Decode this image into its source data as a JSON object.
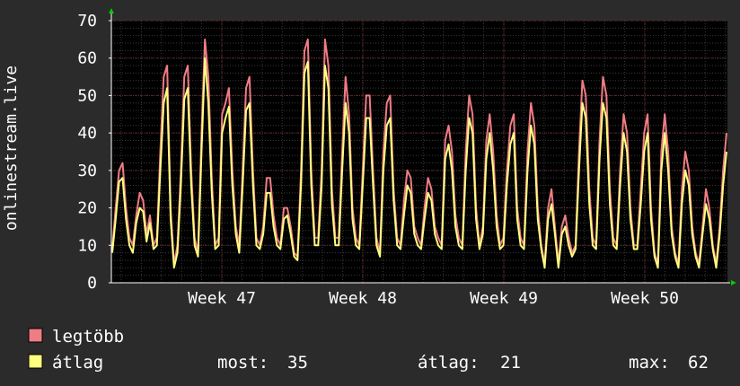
{
  "chart_data": {
    "type": "line",
    "title": "",
    "ylabel": "onlinestream.live",
    "ylim": [
      0,
      70
    ],
    "yticks": [
      0,
      10,
      20,
      30,
      40,
      50,
      60,
      70
    ],
    "xticks": [
      "Week 47",
      "Week 48",
      "Week 49",
      "Week 50"
    ],
    "grid": true,
    "legend": "bottom",
    "series": [
      {
        "name": "legtöbb",
        "color": "#f07c84",
        "values": [
          9,
          20,
          30,
          32,
          20,
          12,
          10,
          18,
          24,
          22,
          13,
          18,
          10,
          12,
          35,
          55,
          58,
          20,
          5,
          10,
          30,
          55,
          58,
          30,
          12,
          8,
          40,
          65,
          55,
          28,
          10,
          12,
          45,
          48,
          52,
          30,
          15,
          10,
          30,
          52,
          55,
          30,
          12,
          10,
          15,
          28,
          28,
          18,
          12,
          10,
          20,
          20,
          15,
          8,
          7,
          30,
          62,
          65,
          30,
          12,
          12,
          30,
          65,
          58,
          25,
          12,
          12,
          35,
          55,
          45,
          20,
          12,
          10,
          30,
          50,
          50,
          30,
          12,
          8,
          35,
          48,
          50,
          25,
          12,
          10,
          22,
          30,
          28,
          15,
          12,
          10,
          20,
          28,
          25,
          15,
          12,
          10,
          38,
          42,
          35,
          18,
          12,
          10,
          35,
          50,
          45,
          20,
          10,
          15,
          38,
          45,
          35,
          18,
          10,
          12,
          30,
          42,
          45,
          20,
          12,
          10,
          35,
          48,
          42,
          20,
          10,
          5,
          20,
          25,
          15,
          5,
          15,
          18,
          12,
          8,
          10,
          35,
          54,
          50,
          25,
          12,
          10,
          38,
          55,
          50,
          25,
          12,
          10,
          30,
          45,
          40,
          20,
          10,
          10,
          25,
          40,
          45,
          20,
          8,
          5,
          35,
          45,
          35,
          15,
          8,
          5,
          25,
          35,
          30,
          15,
          8,
          5,
          15,
          25,
          20,
          10,
          5,
          15,
          30,
          40
        ]
      },
      {
        "name": "átlag",
        "color": "#ffff80",
        "values": [
          8,
          17,
          27,
          28,
          17,
          10,
          8,
          16,
          20,
          19,
          11,
          16,
          9,
          10,
          30,
          48,
          52,
          17,
          4,
          8,
          26,
          49,
          52,
          26,
          10,
          7,
          35,
          60,
          48,
          24,
          9,
          10,
          40,
          44,
          47,
          26,
          13,
          8,
          26,
          46,
          48,
          26,
          10,
          9,
          13,
          24,
          24,
          15,
          10,
          9,
          17,
          18,
          13,
          7,
          6,
          26,
          56,
          59,
          26,
          10,
          10,
          26,
          58,
          52,
          21,
          10,
          10,
          30,
          48,
          40,
          17,
          10,
          9,
          26,
          44,
          44,
          26,
          10,
          7,
          30,
          42,
          44,
          22,
          10,
          9,
          18,
          26,
          24,
          13,
          10,
          9,
          17,
          24,
          22,
          13,
          10,
          9,
          33,
          37,
          30,
          15,
          10,
          9,
          30,
          44,
          40,
          17,
          9,
          13,
          33,
          40,
          30,
          15,
          9,
          10,
          26,
          37,
          40,
          17,
          10,
          9,
          30,
          42,
          37,
          17,
          9,
          4,
          17,
          21,
          13,
          4,
          13,
          15,
          10,
          7,
          9,
          30,
          48,
          44,
          21,
          10,
          9,
          33,
          48,
          44,
          21,
          10,
          9,
          26,
          40,
          35,
          17,
          9,
          9,
          21,
          35,
          40,
          17,
          7,
          4,
          30,
          40,
          30,
          13,
          7,
          4,
          21,
          30,
          26,
          13,
          7,
          4,
          13,
          21,
          17,
          9,
          4,
          13,
          26,
          35
        ]
      }
    ]
  },
  "legend": {
    "items": [
      {
        "label": "legtöbb",
        "color": "#f07c84"
      },
      {
        "label": "átlag",
        "color": "#ffff80"
      }
    ],
    "stats": [
      {
        "label": "most:",
        "value": "35"
      },
      {
        "label": "átlag:",
        "value": "21"
      },
      {
        "label": "max:",
        "value": "62"
      }
    ]
  },
  "colors": {
    "background": "#2b2b2b",
    "plot_background": "#000000",
    "grid_major": "#6b2a2a",
    "grid_minor": "#3a3a3a",
    "axis_arrow": "#00cc00"
  }
}
